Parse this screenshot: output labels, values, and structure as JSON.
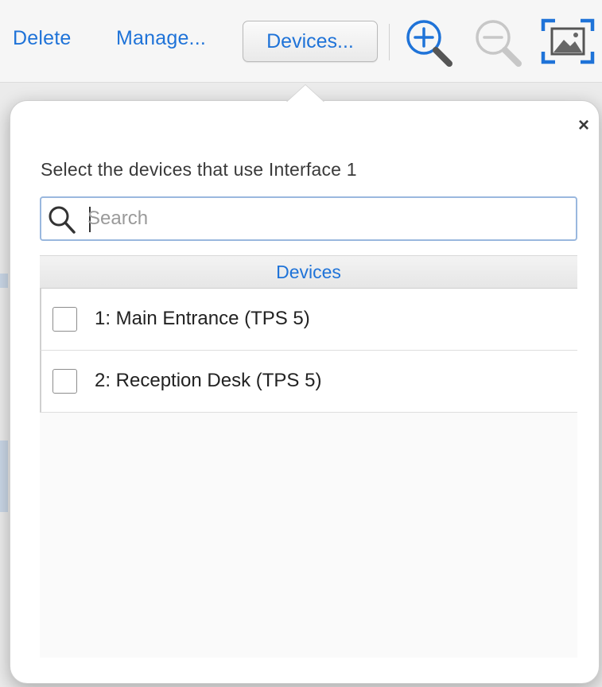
{
  "toolbar": {
    "delete_label": "Delete",
    "manage_label": "Manage...",
    "devices_label": "Devices...",
    "zoom_in_icon": "zoom-in-icon",
    "zoom_out_icon": "zoom-out-icon",
    "fit_image_icon": "fit-image-icon"
  },
  "popover": {
    "close_label": "×",
    "prompt": "Select the devices that use Interface 1",
    "search": {
      "placeholder": "Search",
      "value": ""
    },
    "table": {
      "header": "Devices",
      "rows": [
        {
          "label": "1: Main Entrance (TPS 5)",
          "checked": false
        },
        {
          "label": "2: Reception Desk (TPS 5)",
          "checked": false
        }
      ]
    }
  },
  "colors": {
    "accent": "#1f73d8",
    "search_border": "#9ab8de",
    "popover_bg": "#ffffff"
  }
}
